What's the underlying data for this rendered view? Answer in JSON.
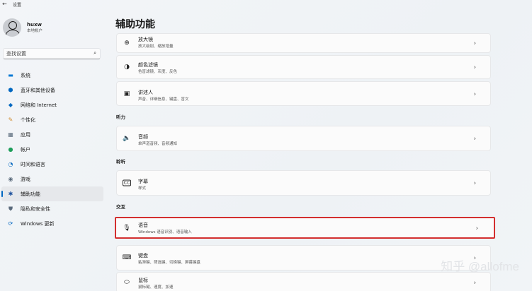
{
  "window": {
    "title": "设置",
    "back_glyph": "←"
  },
  "user": {
    "name": "huxw",
    "account_type": "本地帐户"
  },
  "search": {
    "placeholder": "查找设置"
  },
  "nav": [
    {
      "label": "系统",
      "icon": "system-icon",
      "glyph": "▬",
      "color": "#0078d4"
    },
    {
      "label": "蓝牙和其他设备",
      "icon": "bluetooth-icon",
      "glyph": "⬢",
      "color": "#0067c0"
    },
    {
      "label": "网络和 Internet",
      "icon": "network-icon",
      "glyph": "◆",
      "color": "#0067c0"
    },
    {
      "label": "个性化",
      "icon": "personalization-icon",
      "glyph": "✎",
      "color": "#d08b2e"
    },
    {
      "label": "应用",
      "icon": "apps-icon",
      "glyph": "▦",
      "color": "#5b6b7c"
    },
    {
      "label": "帐户",
      "icon": "accounts-icon",
      "glyph": "●",
      "color": "#1e9e5a"
    },
    {
      "label": "时间和语言",
      "icon": "time-language-icon",
      "glyph": "◔",
      "color": "#0067c0"
    },
    {
      "label": "游戏",
      "icon": "gaming-icon",
      "glyph": "◉",
      "color": "#5b6b7c"
    },
    {
      "label": "辅助功能",
      "icon": "accessibility-icon",
      "glyph": "✱",
      "color": "#1a4f9c",
      "active": true
    },
    {
      "label": "隐私和安全性",
      "icon": "privacy-icon",
      "glyph": "⛊",
      "color": "#5b6b7c"
    },
    {
      "label": "Windows 更新",
      "icon": "windows-update-icon",
      "glyph": "⟳",
      "color": "#0067c0"
    }
  ],
  "main": {
    "title": "辅助功能",
    "cards_top": [
      {
        "title": "放大镜",
        "sub": "放大级别、缩放增量",
        "icon": "magnifier-icon",
        "glyph": "⊕"
      },
      {
        "title": "颜色滤镜",
        "sub": "色盲滤镜、灰度、反色",
        "icon": "color-filters-icon",
        "glyph": "◑"
      },
      {
        "title": "讲述人",
        "sub": "声音、详细信息、键盘、盲文",
        "icon": "narrator-icon",
        "glyph": "▣"
      }
    ],
    "section_hearing": "听力",
    "card_audio": {
      "title": "音频",
      "sub": "单声道音频、音频通知",
      "icon": "audio-icon",
      "glyph": "🔈"
    },
    "section_caption": "聆听",
    "card_captions": {
      "title": "字幕",
      "sub": "样式",
      "icon": "captions-icon",
      "glyph": "CC"
    },
    "section_interaction": "交互",
    "card_speech": {
      "title": "语音",
      "sub": "Windows 语音识别、语音输入",
      "icon": "microphone-icon",
      "glyph": "🎙"
    },
    "card_keyboard": {
      "title": "键盘",
      "sub": "粘滞键、筛选键、切换键、屏幕键盘",
      "icon": "keyboard-icon",
      "glyph": "⌨"
    },
    "card_mouse": {
      "title": "鼠标",
      "sub": "鼠标键、速度、加速",
      "icon": "mouse-icon",
      "glyph": "⬭"
    }
  },
  "chevron": "›",
  "watermark": "知乎 @allofme"
}
